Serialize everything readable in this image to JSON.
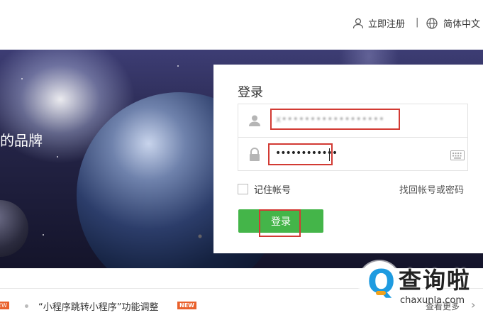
{
  "header": {
    "register_label": "立即注册",
    "separator": "|",
    "language_label": "简体中文"
  },
  "hero": {
    "tagline": "的品牌"
  },
  "login": {
    "title": "登录",
    "username_value": "x••••••••••••••••••",
    "password_value": "••••••••••••",
    "remember_label": "记住帐号",
    "forgot_label": "找回帐号或密码",
    "submit_label": "登录"
  },
  "news": {
    "left_badge": "NEW",
    "item_text": "“小程序跳转小程序”功能调整",
    "item_badge": "NEW",
    "more_label": "查看更多",
    "chevron": "›"
  },
  "watermark": {
    "logo_letter": "Q",
    "title": "查询啦",
    "subtitle": "chaxunla.com"
  },
  "colors": {
    "accent_green": "#44b549",
    "highlight_red": "#d23a33",
    "badge_orange": "#e9612c"
  }
}
